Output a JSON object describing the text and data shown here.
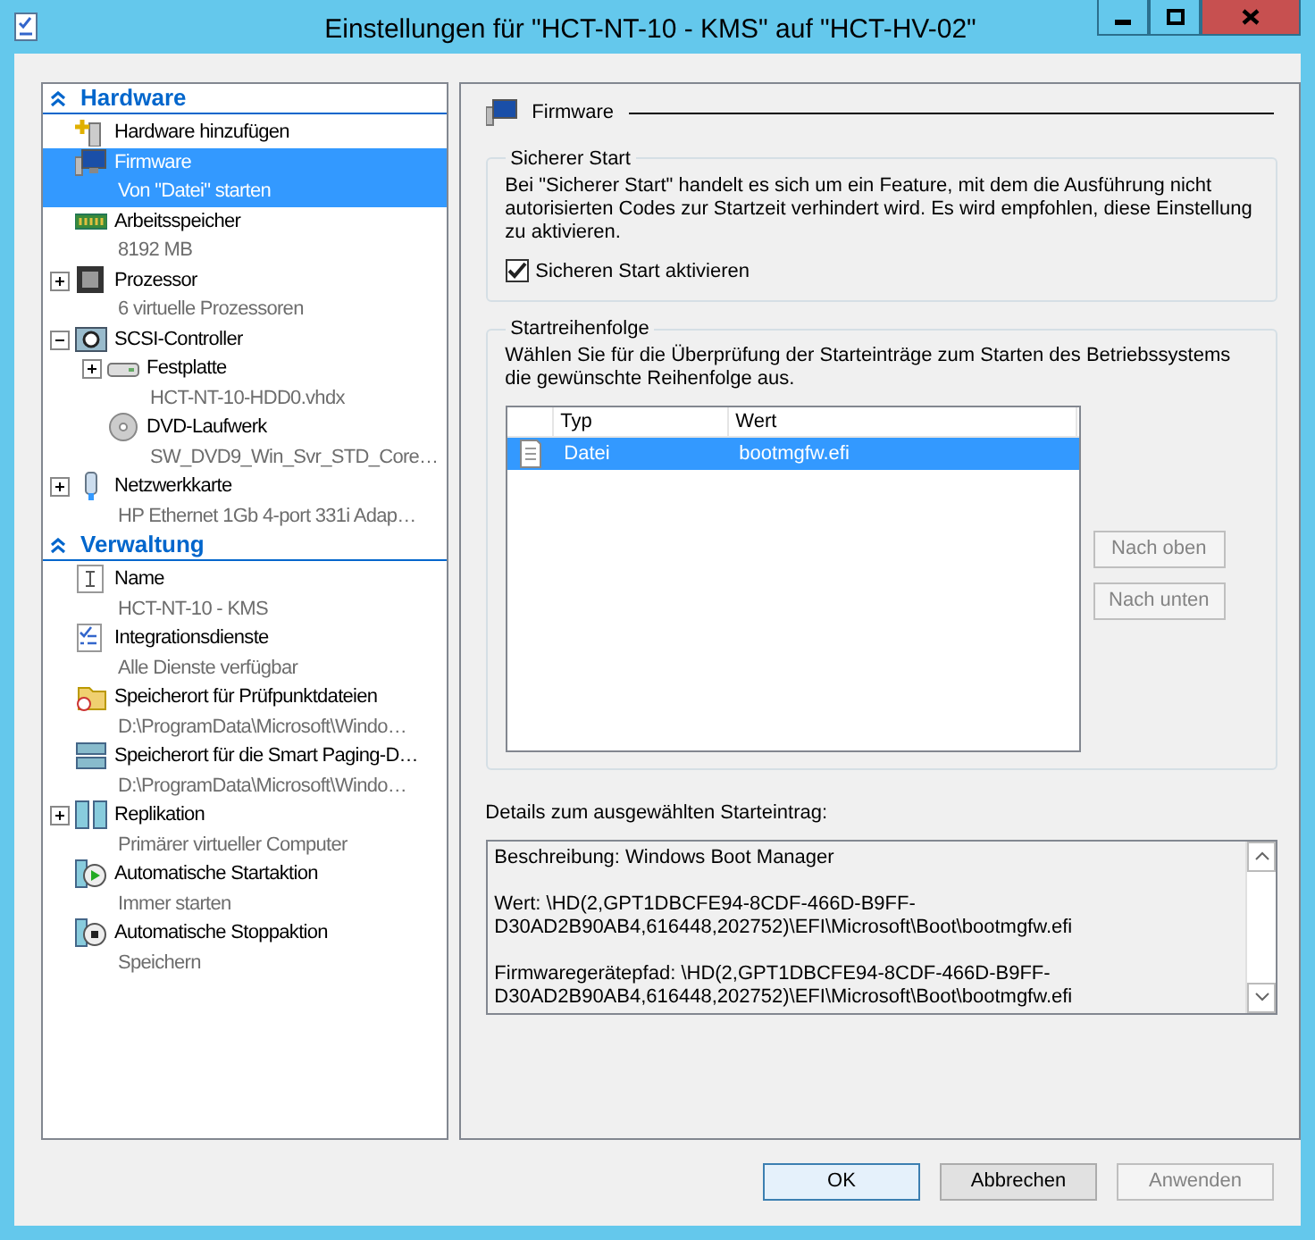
{
  "window": {
    "title": "Einstellungen für \"HCT-NT-10 - KMS\" auf \"HCT-HV-02\""
  },
  "sidebar": {
    "sections": [
      {
        "title": "Hardware",
        "expanded": true,
        "items": [
          {
            "kind": "add",
            "label": "Hardware hinzufügen",
            "selected": false
          },
          {
            "kind": "monitor",
            "label": "Firmware",
            "detail": "Von \"Datei\" starten",
            "selected": true
          },
          {
            "kind": "memory",
            "label": "Arbeitsspeicher",
            "detail": "8192 MB",
            "selected": false
          },
          {
            "kind": "cpu",
            "label": "Prozessor",
            "detail": "6 virtuelle Prozessoren",
            "selected": false,
            "expanded": false
          },
          {
            "kind": "controller",
            "label": "SCSI-Controller",
            "selected": false,
            "expanded": true,
            "children": [
              {
                "kind": "disk",
                "label": "Festplatte",
                "detail": "HCT-NT-10-HDD0.vhdx",
                "selected": false,
                "expanded": false
              },
              {
                "kind": "dvd",
                "label": "DVD-Laufwerk",
                "detail": "SW_DVD9_Win_Svr_STD_Core…",
                "selected": false
              }
            ]
          },
          {
            "kind": "network",
            "label": "Netzwerkkarte",
            "detail": "HP Ethernet 1Gb 4-port 331i Adap…",
            "selected": false,
            "expanded": false
          }
        ]
      },
      {
        "title": "Verwaltung",
        "expanded": true,
        "items": [
          {
            "kind": "name",
            "label": "Name",
            "detail": "HCT-NT-10 - KMS",
            "selected": false
          },
          {
            "kind": "checklist",
            "label": "Integrationsdienste",
            "detail": "Alle Dienste verfügbar",
            "selected": false
          },
          {
            "kind": "folder",
            "label": "Speicherort für Prüfpunktdateien",
            "detail": "D:\\ProgramData\\Microsoft\\Windo…",
            "selected": false
          },
          {
            "kind": "paging",
            "label": "Speicherort für die Smart Paging-D…",
            "detail": "D:\\ProgramData\\Microsoft\\Windo…",
            "selected": false
          },
          {
            "kind": "replication",
            "label": "Replikation",
            "detail": "Primärer virtueller Computer",
            "selected": false,
            "expanded": false
          },
          {
            "kind": "start",
            "label": "Automatische Startaktion",
            "detail": "Immer starten",
            "selected": false
          },
          {
            "kind": "stop",
            "label": "Automatische Stoppaktion",
            "detail": "Speichern",
            "selected": false
          }
        ]
      }
    ]
  },
  "panel": {
    "title": "Firmware",
    "secure_boot": {
      "legend": "Sicherer Start",
      "description": "Bei \"Sicherer Start\" handelt es sich um ein Feature, mit dem die Ausführung nicht autorisierten Codes zur Startzeit verhindert wird. Es wird empfohlen, diese Einstellung zu aktivieren.",
      "checkbox": {
        "label": "Sicheren Start aktivieren",
        "checked": true
      }
    },
    "boot_order": {
      "legend": "Startreihenfolge",
      "description": "Wählen Sie für die Überprüfung der Starteinträge zum Starten des Betriebssystems die gewünschte Reihenfolge aus.",
      "columns": [
        "Typ",
        "Wert"
      ],
      "rows": [
        {
          "type": "Datei",
          "value": "bootmgfw.efi",
          "selected": true
        }
      ],
      "buttons": [
        {
          "label": "Nach oben",
          "disabled": true
        },
        {
          "label": "Nach unten",
          "disabled": true
        }
      ]
    },
    "details": {
      "label": "Details zum ausgewählten Starteintrag:",
      "paragraphs": [
        "Beschreibung: Windows Boot Manager",
        "Wert: \\HD(2,GPT1DBCFE94-8CDF-466D-B9FF-D30AD2B90AB4,616448,202752)\\EFI\\Microsoft\\Boot\\bootmgfw.efi",
        "Firmwaregerätepfad: \\HD(2,GPT1DBCFE94-8CDF-466D-B9FF-D30AD2B90AB4,616448,202752)\\EFI\\Microsoft\\Boot\\bootmgfw.efi"
      ]
    }
  },
  "buttons": [
    {
      "label": "OK",
      "default": true,
      "disabled": false
    },
    {
      "label": "Abbrechen",
      "default": false,
      "disabled": false
    },
    {
      "label": "Anwenden",
      "default": false,
      "disabled": true
    }
  ]
}
